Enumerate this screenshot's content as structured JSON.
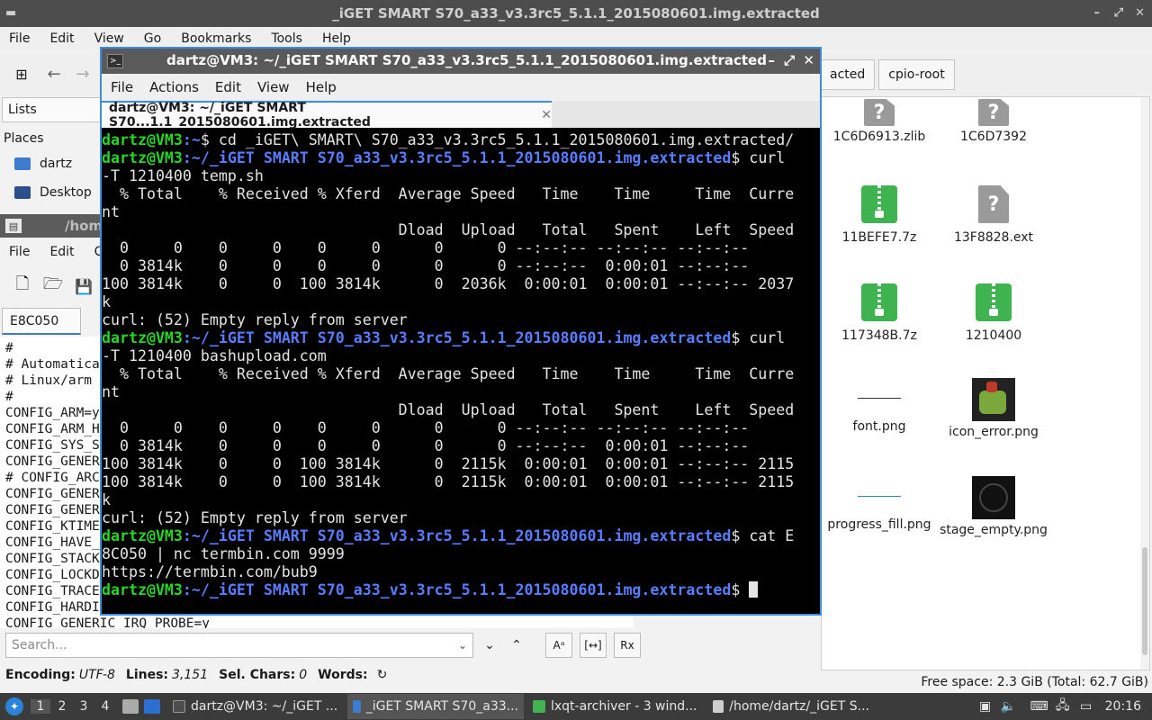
{
  "file_manager": {
    "title": "_iGET SMART S70_a33_v3.3rc5_5.1.1_2015080601.img.extracted",
    "menu": [
      "File",
      "Edit",
      "View",
      "Go",
      "Bookmarks",
      "Tools",
      "Help"
    ],
    "lists_label": "Lists",
    "places_label": "Places",
    "places": [
      "dartz",
      "Desktop"
    ],
    "tabs": [
      "acted",
      "cpio-root"
    ],
    "items": [
      {
        "label": "1C6D6913.zlib",
        "icon": "unknown-file-icon"
      },
      {
        "label": "1C6D7392",
        "icon": "unknown-file-icon"
      },
      {
        "label": "11BEFE7.7z",
        "icon": "archive-icon"
      },
      {
        "label": "13F8828.ext",
        "icon": "unknown-file-icon"
      },
      {
        "label": "117348B.7z",
        "icon": "archive-icon"
      },
      {
        "label": "1210400",
        "icon": "archive-icon"
      },
      {
        "label": "font.png",
        "icon": "image-thumbnail"
      },
      {
        "label": "icon_error.png",
        "icon": "image-thumbnail"
      },
      {
        "label": "progress_fill.png",
        "icon": "image-thumbnail"
      },
      {
        "label": "stage_empty.png",
        "icon": "image-thumbnail"
      }
    ],
    "status": "Free space: 2.3 GiB (Total: 62.7 GiB)"
  },
  "editor": {
    "title": "/hom",
    "menu": [
      "File",
      "Edit",
      "C"
    ],
    "tab_label": "E8C050",
    "code_lines": [
      "#",
      "# Automatica",
      "# Linux/arm",
      "#",
      "CONFIG_ARM=y",
      "CONFIG_ARM_H",
      "CONFIG_SYS_S",
      "CONFIG_GENER",
      "# CONFIG_ARC",
      "CONFIG_GENER",
      "CONFIG_GENER",
      "CONFIG_KTIME",
      "CONFIG_HAVE_",
      "CONFIG_STACK",
      "CONFIG_LOCKD",
      "CONFIG_TRACE",
      "CONFIG_HARDI",
      "CONFIG_GENERIC_IRQ_PROBE=y"
    ],
    "search_placeholder": "Search...",
    "status": {
      "encoding_label": "Encoding:",
      "encoding": "UTF-8",
      "lines_label": "Lines:",
      "lines": "3,151",
      "sel_label": "Sel. Chars:",
      "sel": "0",
      "words_label": "Words:"
    }
  },
  "terminal": {
    "title": "dartz@VM3: ~/_iGET SMART S70_a33_v3.3rc5_5.1.1_2015080601.img.extracted",
    "menu": [
      "File",
      "Actions",
      "Edit",
      "View",
      "Help"
    ],
    "tab_label": "dartz@VM3: ~/_iGET SMART S70...1.1_2015080601.img.extracted",
    "lines": [
      {
        "u": "dartz@VM3",
        "p": ":~",
        "t": "$ cd _iGET\\ SMART\\ S70_a33_v3.3rc5_5.1.1_2015080601.img.extracted/"
      },
      {
        "u": "dartz@VM3",
        "p": ":~/_iGET SMART S70_a33_v3.3rc5_5.1.1_2015080601.img.extracted",
        "t": "$ curl"
      },
      {
        "t": "-T 1210400 temp.sh"
      },
      {
        "t": "  % Total    % Received % Xferd  Average Speed   Time    Time     Time  Curre"
      },
      {
        "t": "nt"
      },
      {
        "t": "                                 Dload  Upload   Total   Spent    Left  Speed"
      },
      {
        "t": "  0     0    0     0    0     0      0      0 --:--:-- --:--:-- --:--:--"
      },
      {
        "t": "  0 3814k    0     0    0     0      0      0 --:--:--  0:00:01 --:--:--"
      },
      {
        "t": "100 3814k    0     0  100 3814k      0  2036k  0:00:01  0:00:01 --:--:-- 2037"
      },
      {
        "t": "k"
      },
      {
        "t": "curl: (52) Empty reply from server"
      },
      {
        "u": "dartz@VM3",
        "p": ":~/_iGET SMART S70_a33_v3.3rc5_5.1.1_2015080601.img.extracted",
        "t": "$ curl"
      },
      {
        "t": "-T 1210400 bashupload.com"
      },
      {
        "t": "  % Total    % Received % Xferd  Average Speed   Time    Time     Time  Curre"
      },
      {
        "t": "nt"
      },
      {
        "t": "                                 Dload  Upload   Total   Spent    Left  Speed"
      },
      {
        "t": "  0     0    0     0    0     0      0      0 --:--:-- --:--:-- --:--:--"
      },
      {
        "t": "  0 3814k    0     0    0     0      0      0 --:--:--  0:00:01 --:--:--"
      },
      {
        "t": "100 3814k    0     0  100 3814k      0  2115k  0:00:01  0:00:01 --:--:-- 2115"
      },
      {
        "t": "100 3814k    0     0  100 3814k      0  2115k  0:00:01  0:00:01 --:--:-- 2115"
      },
      {
        "t": "k"
      },
      {
        "t": "curl: (52) Empty reply from server"
      },
      {
        "u": "dartz@VM3",
        "p": ":~/_iGET SMART S70_a33_v3.3rc5_5.1.1_2015080601.img.extracted",
        "t": "$ cat E"
      },
      {
        "t": "8C050 | nc termbin.com 9999"
      },
      {
        "t": "https://termbin.com/bub9"
      },
      {
        "u": "dartz@VM3",
        "p": ":~/_iGET SMART S70_a33_v3.3rc5_5.1.1_2015080601.img.extracted",
        "t": "$ ",
        "cursor": true
      }
    ]
  },
  "taskbar": {
    "desktops": [
      "1",
      "2",
      "3",
      "4"
    ],
    "tasks": [
      {
        "label": "dartz@VM3: ~/_iGET ...",
        "color": "#4d4d4d"
      },
      {
        "label": "_iGET SMART S70_a33...",
        "color": "#3d7bd1"
      },
      {
        "label": "lxqt-archiver - 3 wind...",
        "color": "#3fb34f"
      },
      {
        "label": "/home/dartz/_iGET S...",
        "color": "#cfcfcf"
      }
    ],
    "clock": "20:16"
  }
}
